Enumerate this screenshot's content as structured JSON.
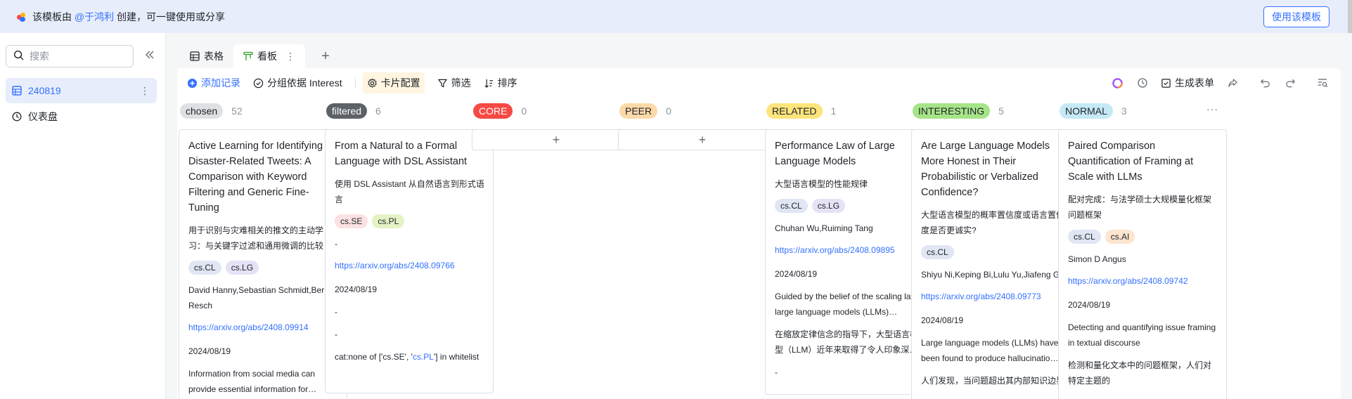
{
  "banner": {
    "prefix": "该模板由",
    "author": "@于鸿利",
    "suffix": "创建，可一键使用或分享",
    "use_button": "使用该模板"
  },
  "sidebar": {
    "search_placeholder": "搜索",
    "items": [
      {
        "label": "240819",
        "icon": "table-icon"
      },
      {
        "label": "仪表盘",
        "icon": "dashboard-icon"
      }
    ]
  },
  "tabs": [
    {
      "label": "表格",
      "icon": "grid-icon"
    },
    {
      "label": "看板",
      "icon": "kanban-icon"
    }
  ],
  "toolbar": {
    "add_record": "添加记录",
    "group_by": "分组依据 Interest",
    "card_config": "卡片配置",
    "filter": "筛选",
    "sort": "排序",
    "generate_form": "生成表单"
  },
  "columns": [
    {
      "label": "chosen",
      "count": "52",
      "bg": "#dee0e3",
      "fg": "#1f2329",
      "card": {
        "title": "Active Learning for Identifying Disaster-Related Tweets: A Comparison with Keyword Filtering and Generic Fine-Tuning",
        "summary_cn": "用于识别与灾难相关的推文的主动学习：与关键字过滤和通用微调的比较",
        "tags": [
          "cs.CL",
          "cs.LG"
        ],
        "authors": "David Hanny,Sebastian Schmidt,Bernd Resch",
        "link": "https://arxiv.org/abs/2408.09914",
        "date": "2024/08/19",
        "abstract": "Information from social media can provide essential information for…"
      }
    },
    {
      "label": "filtered",
      "count": "6",
      "bg": "#5d6168",
      "fg": "#ffffff",
      "card": {
        "title": "From a Natural to a Formal Language with DSL Assistant",
        "summary_cn": "使用 DSL Assistant 从自然语言到形式语言",
        "tags": [
          "cs.SE",
          "cs.PL"
        ],
        "dash1": "-",
        "link": "https://arxiv.org/abs/2408.09766",
        "date": "2024/08/19",
        "dash2": "-",
        "dash3": "-",
        "cat_prefix": "cat:none of ['cs.SE', '",
        "cat_blue": "cs.PL",
        "cat_suffix": "'] in whitelist"
      }
    },
    {
      "label": "CORE",
      "count": "0",
      "bg": "#f54a45",
      "fg": "#ffffff",
      "add": "+"
    },
    {
      "label": "PEER",
      "count": "0",
      "bg": "#fcd9a8",
      "fg": "#1f2329",
      "add": "+"
    },
    {
      "label": "RELATED",
      "count": "1",
      "bg": "#fde57c",
      "fg": "#1f2329",
      "card": {
        "title": "Performance Law of Large Language Models",
        "summary_cn": "大型语言模型的性能规律",
        "tags": [
          "cs.CL",
          "cs.LG"
        ],
        "authors": "Chuhan Wu,Ruiming Tang",
        "link": "https://arxiv.org/abs/2408.09895",
        "date": "2024/08/19",
        "abstract": "Guided by the belief of the scaling law, large language models (LLMs)…",
        "abstract_cn": "在缩放定律信念的指导下，大型语言模型（LLM）近年来取得了令人印象深…",
        "dash": "-"
      }
    },
    {
      "label": "INTERESTING",
      "count": "5",
      "bg": "#a6e488",
      "fg": "#1f2329",
      "card": {
        "title": "Are Large Language Models More Honest in Their Probabilistic or Verbalized Confidence?",
        "summary_cn": "大型语言模型的概率置信度或语言置信度是否更诚实?",
        "tags": [
          "cs.CL"
        ],
        "authors": "Shiyu Ni,Keping Bi,Lulu Yu,Jiafeng Guo",
        "link": "https://arxiv.org/abs/2408.09773",
        "date": "2024/08/19",
        "abstract": "Large language models (LLMs) have been found to produce hallucinatio…",
        "abstract_cn": "人们发现，当问题超出其内部知识边界"
      }
    },
    {
      "label": "NORMAL",
      "count": "3",
      "bg": "#c5e9f5",
      "fg": "#1f2329",
      "card": {
        "title": "Paired Comparison Quantification of Framing at Scale with LLMs",
        "summary_cn": "配对完成：与法学硕士大规模量化框架问题框架",
        "tags": [
          "cs.CL",
          "cs.AI"
        ],
        "authors": "Simon D Angus",
        "link": "https://arxiv.org/abs/2408.09742",
        "date": "2024/08/19",
        "abstract": "Detecting and quantifying issue framing in textual discourse",
        "abstract_cn": "检测和量化文本中的问题框架，人们对特定主题的"
      }
    }
  ]
}
